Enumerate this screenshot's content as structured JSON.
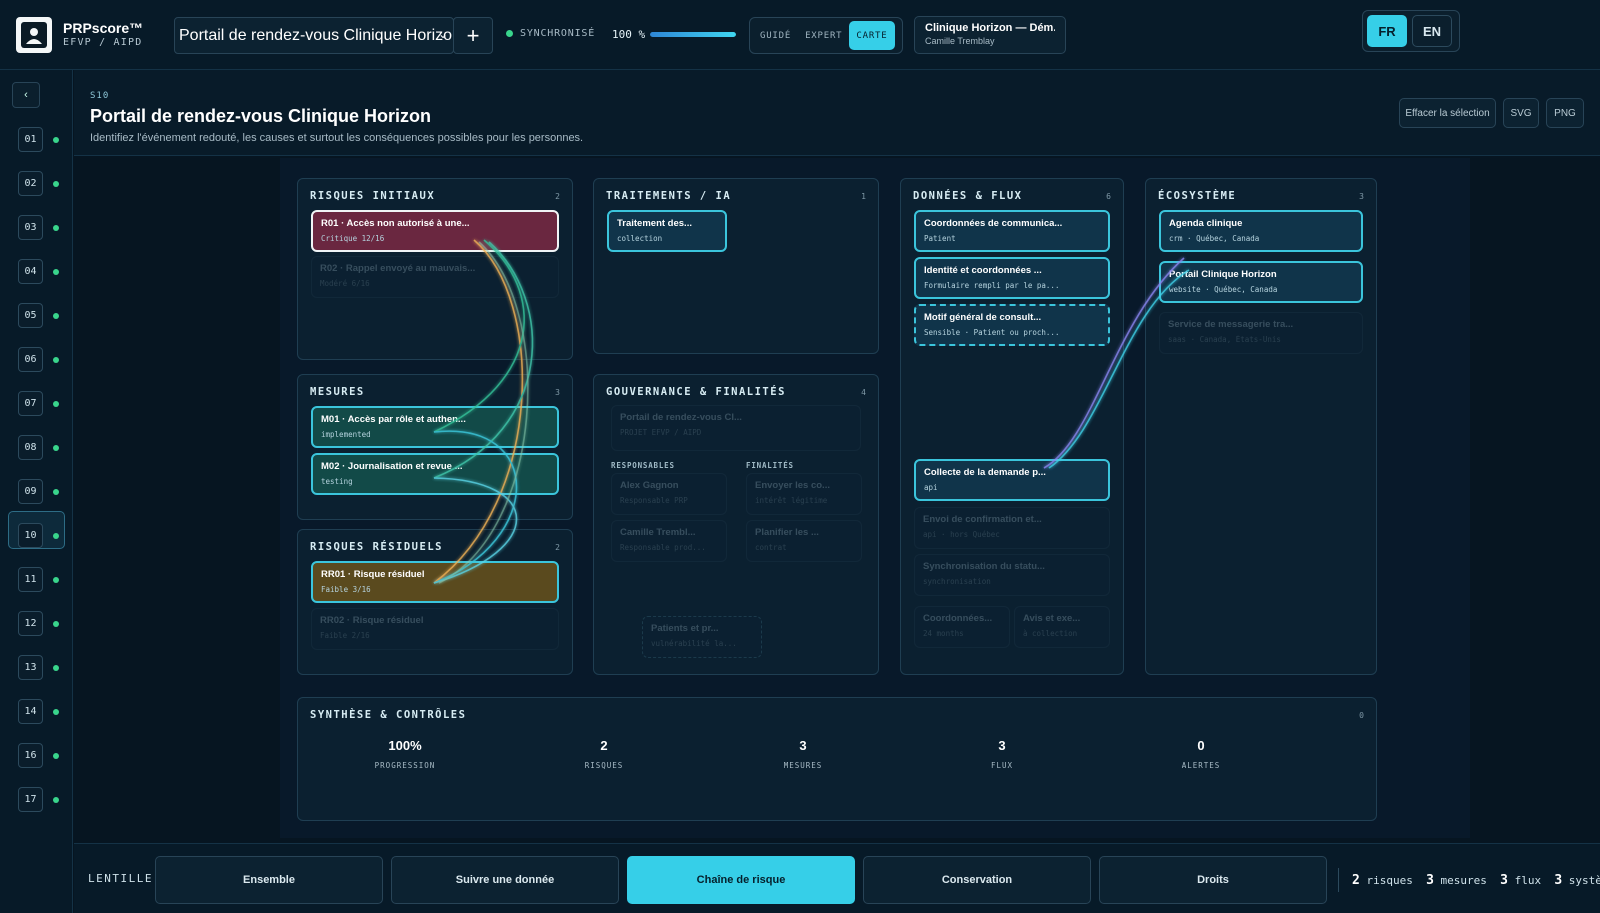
{
  "brand": {
    "title": "PRPscore™",
    "subtitle": "EFVP / AIPD"
  },
  "project_select": {
    "value": "Portail de rendez-vous Clinique Horizon"
  },
  "toolbar": {
    "add_label": "+"
  },
  "sync_status": {
    "label": "SYNCHRONISÉ",
    "color": "#39d58c"
  },
  "progress": {
    "label": "100 %",
    "value": 100
  },
  "modes": [
    {
      "label": "GUIDÉ",
      "active": false
    },
    {
      "label": "EXPERT",
      "active": false
    },
    {
      "label": "CARTE",
      "active": true
    }
  ],
  "org": {
    "name": "Clinique Horizon — Dém...",
    "user": "Camille Tremblay"
  },
  "languages": [
    {
      "label": "FR",
      "active": true
    },
    {
      "label": "EN",
      "active": false
    }
  ],
  "sidebar": {
    "collapse_label": "‹",
    "steps": [
      "01",
      "02",
      "03",
      "04",
      "05",
      "06",
      "07",
      "08",
      "09",
      "10",
      "11",
      "12",
      "13",
      "14",
      "16",
      "17"
    ],
    "active_step": "10"
  },
  "page": {
    "code": "S10",
    "title": "Portail de rendez-vous Clinique Horizon",
    "subtitle": "Identifiez l'événement redouté, les causes et surtout les conséquences possibles pour les personnes.",
    "actions": {
      "clear": "Effacer la sélection",
      "svg": "SVG",
      "png": "PNG"
    }
  },
  "panels": {
    "risks": {
      "title": "RISQUES INITIAUX",
      "count": "2",
      "items": [
        {
          "title": "R01 · Accès non autorisé à une...",
          "sub": "Critique 12/16"
        },
        {
          "title": "R02 · Rappel envoyé au mauvais...",
          "sub": "Modéré 6/16"
        }
      ]
    },
    "measures": {
      "title": "MESURES",
      "count": "3",
      "items": [
        {
          "title": "M01 · Accès par rôle et authen...",
          "sub": "implemented"
        },
        {
          "title": "M02 · Journalisation et revue ...",
          "sub": "testing"
        }
      ]
    },
    "residual": {
      "title": "RISQUES RÉSIDUELS",
      "count": "2",
      "items": [
        {
          "title": "RR01 · Risque résiduel",
          "sub": "Faible 3/16"
        },
        {
          "title": "RR02 · Risque résiduel",
          "sub": "Faible 2/16"
        }
      ]
    },
    "processing": {
      "title": "TRAITEMENTS / IA",
      "count": "1",
      "items": [
        {
          "title": "Traitement des...",
          "sub": "collection"
        }
      ]
    },
    "governance": {
      "title": "GOUVERNANCE & FINALITÉS",
      "count": "4",
      "project": {
        "title": "Portail de rendez-vous Cl...",
        "sub": "PROJET EFVP / AIPD"
      },
      "owners_label": "RESPONSABLES",
      "purposes_label": "FINALITÉS",
      "owners": [
        {
          "title": "Alex Gagnon",
          "sub": "Responsable PRP"
        },
        {
          "title": "Camille Trembl...",
          "sub": "Responsable prod..."
        }
      ],
      "purposes": [
        {
          "title": "Envoyer les co...",
          "sub": "intérêt légitime"
        },
        {
          "title": "Planifier les ...",
          "sub": "contrat"
        }
      ],
      "people": {
        "title": "Patients et pr...",
        "sub": "vulnérabilité la..."
      }
    },
    "data": {
      "title": "DONNÉES & FLUX",
      "count": "6",
      "items": [
        {
          "title": "Coordonnées de communica...",
          "sub": "Patient"
        },
        {
          "title": "Identité et coordonnées ...",
          "sub": "Formulaire rempli par le pa..."
        },
        {
          "title": "Motif général de consult...",
          "sub": "Sensible · Patient ou proch..."
        }
      ],
      "flows": [
        {
          "title": "Collecte de la demande p...",
          "sub": "api"
        },
        {
          "title": "Envoi de confirmation et...",
          "sub": "api · hors Québec"
        },
        {
          "title": "Synchronisation du statu...",
          "sub": "synchronisation"
        }
      ],
      "small": [
        {
          "title": "Coordonnées...",
          "sub": "24 months"
        },
        {
          "title": "Avis et exe...",
          "sub": "à collection"
        }
      ]
    },
    "ecosystem": {
      "title": "ÉCOSYSTÈME",
      "count": "3",
      "items": [
        {
          "title": "Agenda clinique",
          "sub": "crm · Québec, Canada"
        },
        {
          "title": "Portail Clinique Horizon",
          "sub": "website · Québec, Canada"
        },
        {
          "title": "Service de messagerie tra...",
          "sub": "saas · Canada, États-Unis"
        }
      ]
    }
  },
  "synthesis": {
    "title": "SYNTHÈSE & CONTRÔLES",
    "count": "0",
    "stats": [
      {
        "value": "100%",
        "label": "PROGRESSION"
      },
      {
        "value": "2",
        "label": "RISQUES"
      },
      {
        "value": "3",
        "label": "MESURES"
      },
      {
        "value": "3",
        "label": "FLUX"
      },
      {
        "value": "0",
        "label": "ALERTES"
      }
    ]
  },
  "lens": {
    "label": "LENTILLE",
    "options": [
      {
        "label": "Ensemble",
        "active": false
      },
      {
        "label": "Suivre une donnée",
        "active": false
      },
      {
        "label": "Chaîne de risque",
        "active": true
      },
      {
        "label": "Conservation",
        "active": false
      },
      {
        "label": "Droits",
        "active": false
      }
    ],
    "summary": {
      "risks_n": "2",
      "risks_l": "risques",
      "measures_n": "3",
      "measures_l": "mesures",
      "flows_n": "3",
      "flows_l": "flux",
      "systems_n": "3",
      "systems_l": "systèmes"
    }
  },
  "colors": {
    "accent": "#36cfe8",
    "critical": "#6a2740",
    "success": "#39d58c"
  }
}
